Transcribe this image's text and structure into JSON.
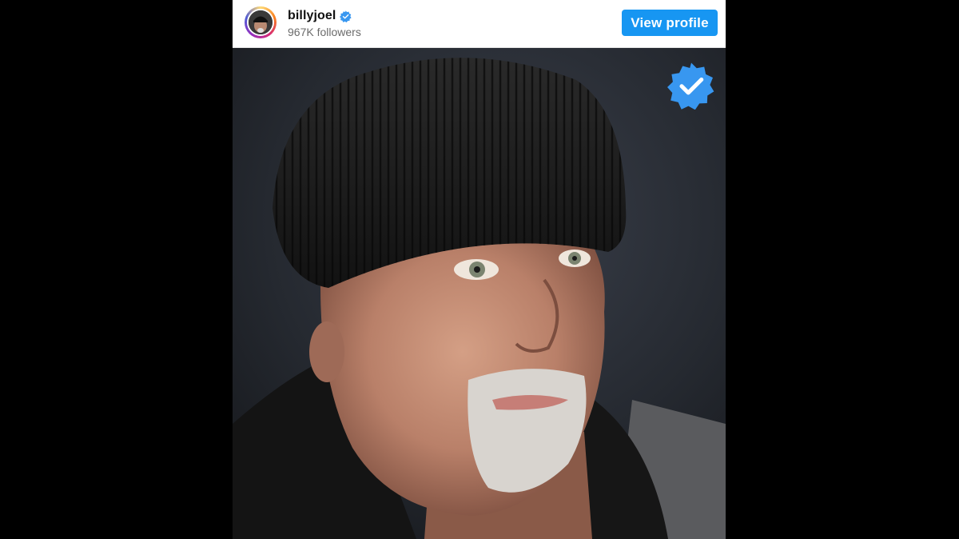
{
  "profile": {
    "username": "billyjoel",
    "followers": "967K followers",
    "verified": true,
    "avatar_icon": "profile-photo-avatar"
  },
  "header": {
    "view_profile_label": "View profile"
  },
  "post": {
    "image_icon": "portrait-photo",
    "verified_badge_icon": "verified-badge-icon"
  },
  "colors": {
    "button_blue": "#1796f2",
    "verified_blue": "#3897f0",
    "frame_background": "#000000"
  }
}
